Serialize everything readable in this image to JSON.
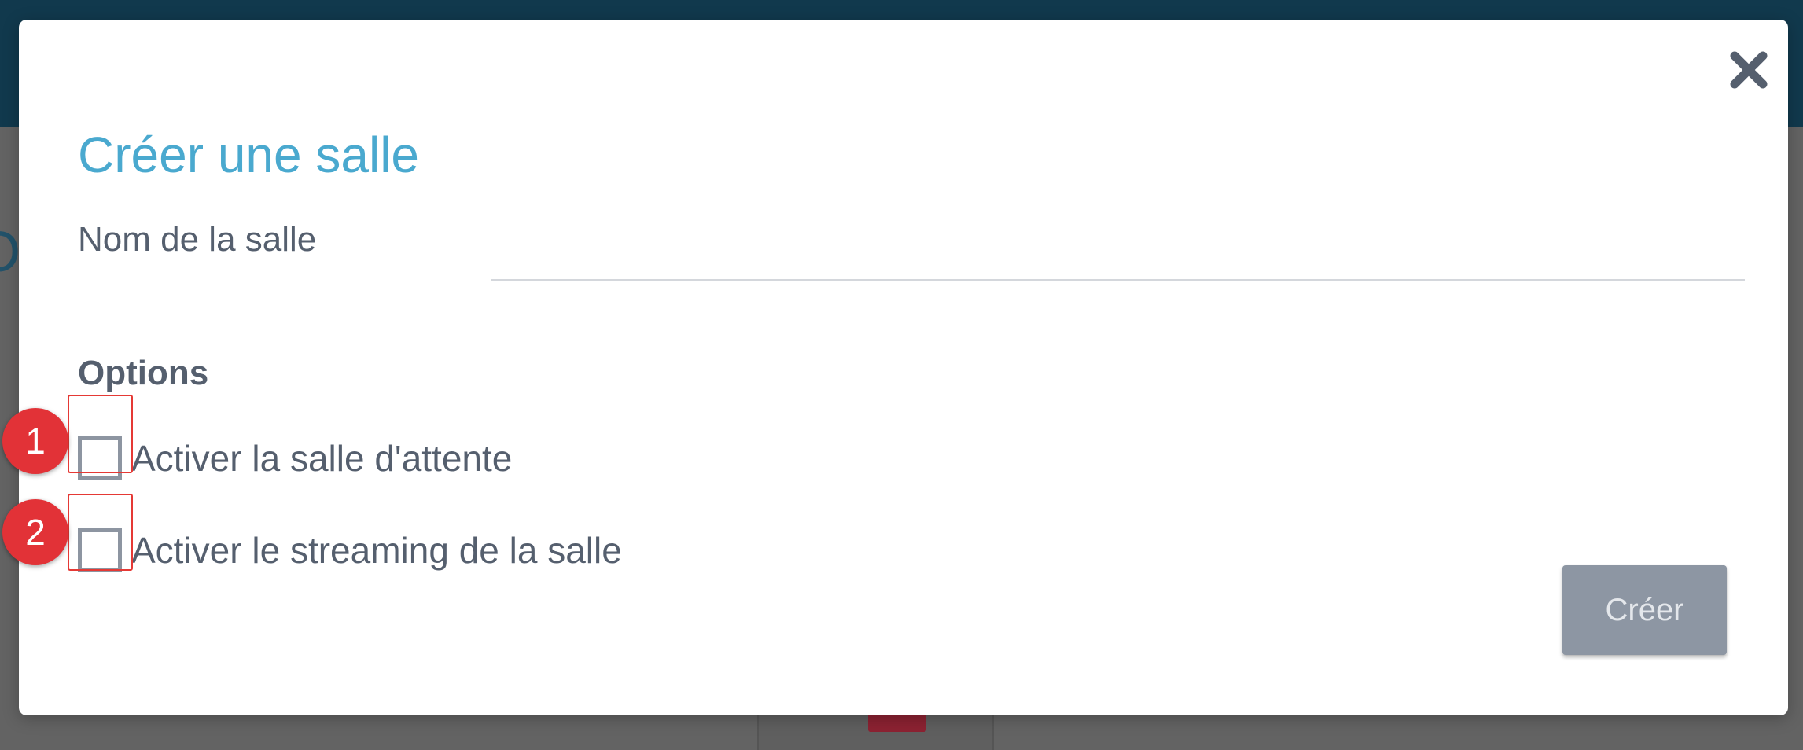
{
  "modal": {
    "title": "Créer une salle",
    "name_label": "Nom de la salle",
    "name_value": "",
    "options_heading": "Options",
    "options": [
      {
        "label": "Activer la salle d'attente",
        "checked": false,
        "marker": "1"
      },
      {
        "label": "Activer le streaming de la salle",
        "checked": false,
        "marker": "2"
      }
    ],
    "create_label": "Créer",
    "create_disabled": true,
    "close_icon": "close-icon"
  },
  "colors": {
    "title": "#4aa9cf",
    "text": "#555f6e",
    "button_disabled": "#8d96a3",
    "marker": "#e23237",
    "topbar": "#11394d"
  }
}
